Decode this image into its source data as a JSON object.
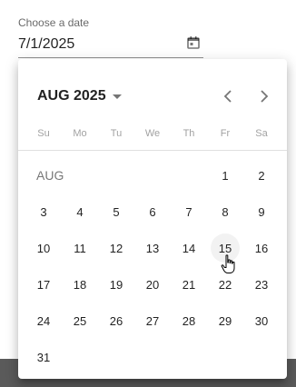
{
  "date_field": {
    "label": "Choose a date",
    "value": "7/1/2025"
  },
  "calendar": {
    "period_label": "AUG 2025",
    "weekdays": [
      "Su",
      "Mo",
      "Tu",
      "We",
      "Th",
      "Fr",
      "Sa"
    ],
    "month_label": "AUG",
    "weeks": [
      [
        "",
        "",
        "",
        "",
        "",
        "1",
        "2"
      ],
      [
        "3",
        "4",
        "5",
        "6",
        "7",
        "8",
        "9"
      ],
      [
        "10",
        "11",
        "12",
        "13",
        "14",
        "15",
        "16"
      ],
      [
        "17",
        "18",
        "19",
        "20",
        "21",
        "22",
        "23"
      ],
      [
        "24",
        "25",
        "26",
        "27",
        "28",
        "29",
        "30"
      ],
      [
        "31",
        "",
        "",
        "",
        "",
        "",
        ""
      ]
    ],
    "hovered_day": "15"
  },
  "icons": {
    "calendar_toggle": "calendar-icon",
    "prev": "chevron-left-icon",
    "next": "chevron-right-icon",
    "period_caret": "caret-down-icon",
    "pointer": "hand-pointer-icon"
  }
}
